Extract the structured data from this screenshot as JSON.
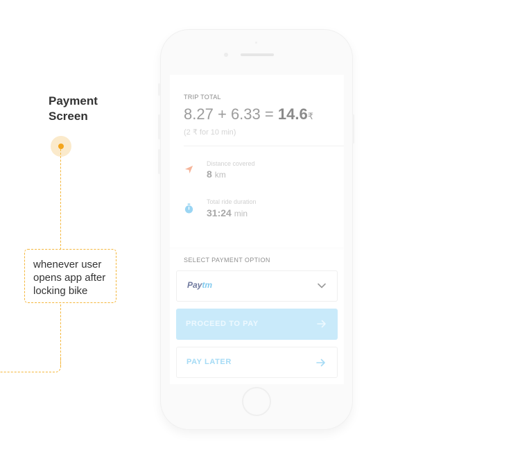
{
  "annotation": {
    "title_line1": "Payment",
    "title_line2": "Screen",
    "note_line1": "whenever user",
    "note_line2": "opens app after",
    "note_line3": "locking bike"
  },
  "trip": {
    "label": "TRIP TOTAL",
    "part1": "8.27",
    "plus": "+",
    "part2": "6.33",
    "equals": "=",
    "total": "14.6",
    "currency": "₹",
    "rate": "(2 ₹ for 10 min)"
  },
  "stats": [
    {
      "label": "Distance covered",
      "value": "8",
      "unit": "km",
      "icon": "navigation-arrow-icon"
    },
    {
      "label": "Total ride duration",
      "value": "31:24",
      "unit": "min",
      "icon": "stopwatch-icon"
    }
  ],
  "payment": {
    "label": "SELECT PAYMENT OPTION",
    "selected_pay": "Pay",
    "selected_tm": "tm",
    "proceed_label": "PROCEED TO PAY",
    "later_label": "PAY LATER"
  },
  "colors": {
    "accent": "#f4a51c",
    "primary_button": "#c9eafa",
    "link_blue": "#a5dbf5"
  }
}
